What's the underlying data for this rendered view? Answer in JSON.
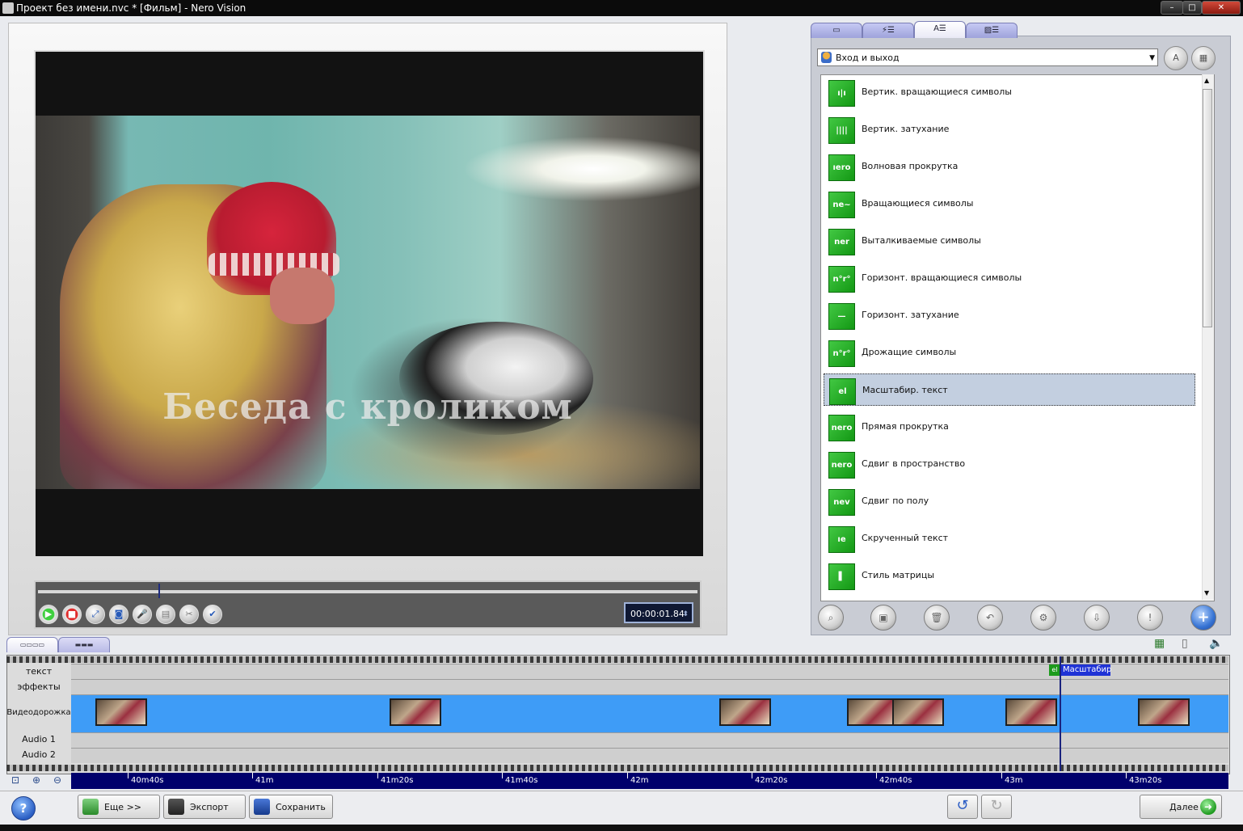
{
  "window": {
    "title": "Проект без имени.nvc * [Фильм] - Nero Vision",
    "controls": [
      "–",
      "□",
      "✕"
    ]
  },
  "preview": {
    "caption": "Беседа с кроликом",
    "timecode": "00:00:01.84",
    "controls": [
      "play",
      "stop",
      "fullscreen",
      "snapshot",
      "record",
      "trim",
      "cut",
      "apply"
    ]
  },
  "right_panel": {
    "tabs": [
      "▭",
      "⚡☰",
      "A☰",
      "▨☰"
    ],
    "active_tab": 2,
    "category": "Вход и выход",
    "effects": [
      {
        "name": "Вертик. вращающиеся символы",
        "thumb": "ı|ı"
      },
      {
        "name": "Вертик. затухание",
        "thumb": "||||"
      },
      {
        "name": "Волновая прокрутка",
        "thumb": "ıero"
      },
      {
        "name": "Вращающиеся символы",
        "thumb": "ne~"
      },
      {
        "name": "Выталкиваемые символы",
        "thumb": "ner"
      },
      {
        "name": "Горизонт. вращающиеся символы",
        "thumb": "n°r°"
      },
      {
        "name": "Горизонт. затухание",
        "thumb": "—"
      },
      {
        "name": "Дрожащие символы",
        "thumb": "n°r°"
      },
      {
        "name": "Масштабир. текст",
        "thumb": "el"
      },
      {
        "name": "Прямая прокрутка",
        "thumb": "nero"
      },
      {
        "name": "Сдвиг в пространство",
        "thumb": "nero"
      },
      {
        "name": "Сдвиг по полу",
        "thumb": "nev"
      },
      {
        "name": "Скрученный текст",
        "thumb": "ıe"
      },
      {
        "name": "Стиль матрицы",
        "thumb": "▌"
      }
    ],
    "selected_index": 8
  },
  "timeline": {
    "tracks": [
      "текст",
      "эффекты",
      "Видеодорожка",
      "Audio 1",
      "Audio 2"
    ],
    "text_clip_label": "Масштабир",
    "text_clip_icon": "el",
    "ruler": [
      "40m40s",
      "41m",
      "41m20s",
      "41m40s",
      "42m",
      "42m20s",
      "42m40s",
      "43m",
      "43m20s"
    ]
  },
  "bottom": {
    "help": "?",
    "more": "Еще >>",
    "export": "Экспорт",
    "save": "Сохранить",
    "next": "Далее"
  },
  "colors": {
    "video_track": "#3e9cf7",
    "ruler_bg": "#00006c",
    "text_clip": "#1f33d6",
    "effect_green": "#2fb52f"
  }
}
